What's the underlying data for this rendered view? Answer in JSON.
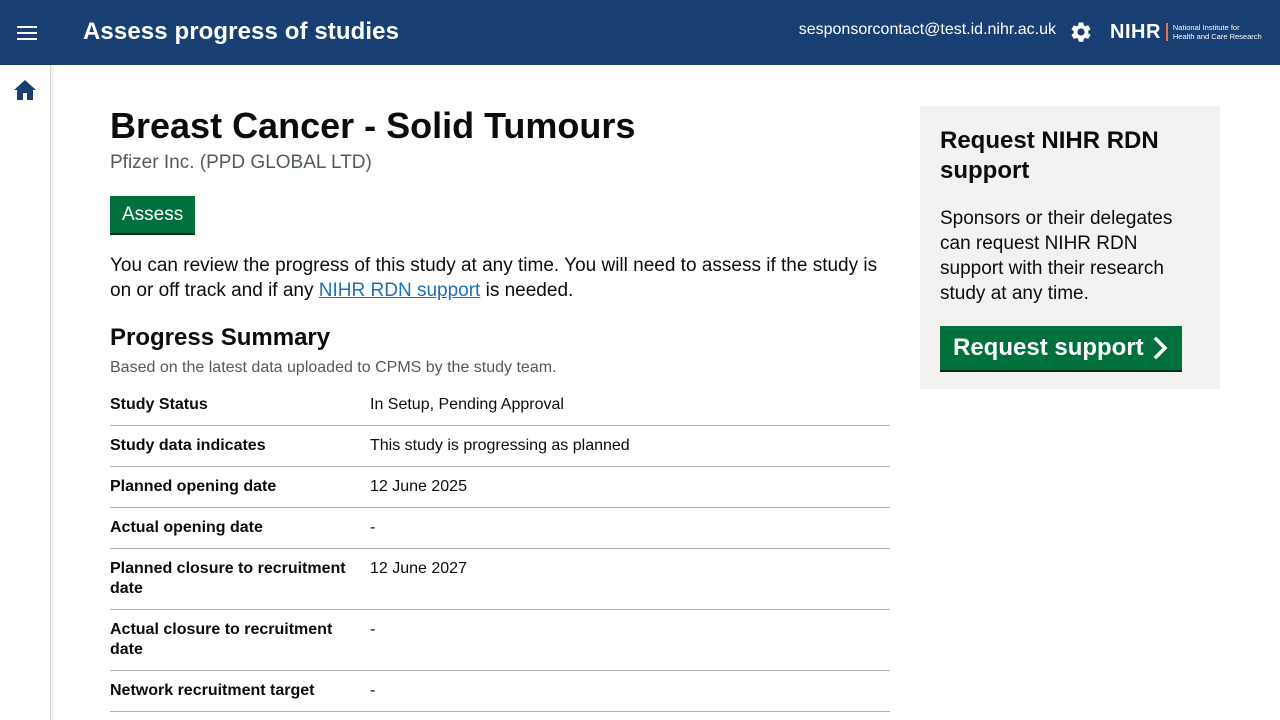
{
  "header": {
    "app_title": "Assess progress of studies",
    "user_email": "sesponsorcontact@test.id.nihr.ac.uk",
    "logo_mark": "NIHR",
    "logo_line1": "National Institute for",
    "logo_line2": "Health and Care Research",
    "menu_icon": "hamburger-icon",
    "settings_icon": "gear-icon"
  },
  "sidenav": {
    "home_icon": "home-icon"
  },
  "study": {
    "title": "Breast Cancer - Solid Tumours",
    "sponsor": "Pfizer Inc. (PPD GLOBAL LTD)",
    "assess_label": "Assess",
    "intro_before": "You can review the progress of this study at any time. You will need to assess if the study is on or off track and if any ",
    "intro_link": "NIHR RDN support",
    "intro_after": " is needed."
  },
  "summary": {
    "heading": "Progress Summary",
    "caption": "Based on the latest data uploaded to CPMS by the study team.",
    "rows": [
      {
        "key": "Study Status",
        "value": "In Setup, Pending Approval"
      },
      {
        "key": "Study data indicates",
        "value": "This study is progressing as planned"
      },
      {
        "key": "Planned opening date",
        "value": "12 June 2025"
      },
      {
        "key": "Actual opening date",
        "value": "-"
      },
      {
        "key": "Planned closure to recruitment date",
        "value": "12 June 2027"
      },
      {
        "key": "Actual closure to recruitment date",
        "value": "-"
      },
      {
        "key": "Network recruitment target",
        "value": "-"
      }
    ]
  },
  "aside": {
    "title": "Request NIHR RDN support",
    "text": "Sponsors or their delegates can request NIHR RDN support with their research study at any time.",
    "button_label": "Request support",
    "button_icon": "chevron-right-icon"
  },
  "colors": {
    "header_bg": "#193e72",
    "button_green": "#00703c",
    "link_blue": "#1d70b8",
    "aside_bg": "#f3f2f1"
  }
}
